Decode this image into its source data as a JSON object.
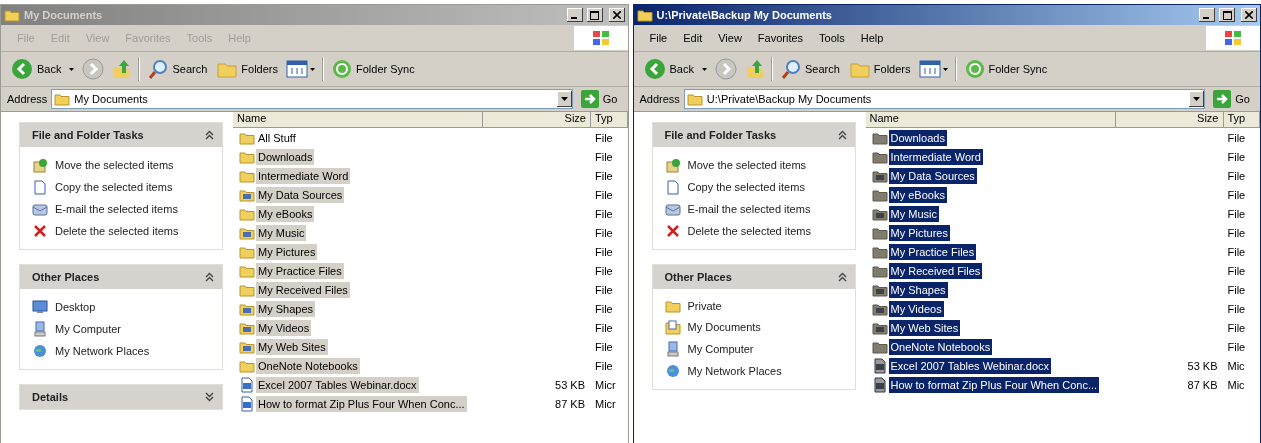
{
  "windows": [
    {
      "title": "My Documents",
      "active": false,
      "menu": [
        "File",
        "Edit",
        "View",
        "Favorites",
        "Tools",
        "Help"
      ],
      "toolbar": {
        "back": "Back",
        "search": "Search",
        "folders": "Folders",
        "sync": "Folder Sync"
      },
      "address": {
        "label": "Address",
        "value": "My Documents",
        "go": "Go"
      },
      "panels": [
        {
          "title": "File and Folder Tasks",
          "expanded": true,
          "items": [
            {
              "label": "Move the selected items",
              "kind": "move"
            },
            {
              "label": "Copy the selected items",
              "kind": "copy"
            },
            {
              "label": "E-mail the selected items",
              "kind": "email"
            },
            {
              "label": "Delete the selected items",
              "kind": "delete"
            }
          ]
        },
        {
          "title": "Other Places",
          "expanded": true,
          "items": [
            {
              "label": "Desktop",
              "kind": "desktop"
            },
            {
              "label": "My Computer",
              "kind": "computer"
            },
            {
              "label": "My Network Places",
              "kind": "network"
            }
          ]
        },
        {
          "title": "Details",
          "expanded": false
        }
      ],
      "columns": [
        "Name",
        "Size",
        "Typ"
      ],
      "files": [
        {
          "name": "All Stuff",
          "type": "File",
          "kind": "folder",
          "selected": false
        },
        {
          "name": "Downloads",
          "type": "File",
          "kind": "folder",
          "selected": true
        },
        {
          "name": "Intermediate Word",
          "type": "File",
          "kind": "folder",
          "selected": true
        },
        {
          "name": "My Data Sources",
          "type": "File",
          "kind": "special",
          "selected": true
        },
        {
          "name": "My eBooks",
          "type": "File",
          "kind": "folder",
          "selected": true
        },
        {
          "name": "My Music",
          "type": "File",
          "kind": "special",
          "selected": true
        },
        {
          "name": "My Pictures",
          "type": "File",
          "kind": "folder",
          "selected": true
        },
        {
          "name": "My Practice Files",
          "type": "File",
          "kind": "folder",
          "selected": true
        },
        {
          "name": "My Received Files",
          "type": "File",
          "kind": "folder",
          "selected": true
        },
        {
          "name": "My Shapes",
          "type": "File",
          "kind": "special",
          "selected": true
        },
        {
          "name": "My Videos",
          "type": "File",
          "kind": "special",
          "selected": true
        },
        {
          "name": "My Web Sites",
          "type": "File",
          "kind": "special",
          "selected": true
        },
        {
          "name": "OneNote Notebooks",
          "type": "File",
          "kind": "folder",
          "selected": true
        },
        {
          "name": "Excel 2007 Tables Webinar.docx",
          "size": "53 KB",
          "type": "Micr",
          "kind": "document",
          "selected": true
        },
        {
          "name": "How to format Zip Plus Four When Conc...",
          "size": "87 KB",
          "type": "Micr",
          "kind": "document",
          "selected": true
        }
      ]
    },
    {
      "title": "U:\\Private\\Backup My Documents",
      "active": true,
      "menu": [
        "File",
        "Edit",
        "View",
        "Favorites",
        "Tools",
        "Help"
      ],
      "toolbar": {
        "back": "Back",
        "search": "Search",
        "folders": "Folders",
        "sync": "Folder Sync"
      },
      "address": {
        "label": "Address",
        "value": "U:\\Private\\Backup My Documents",
        "go": "Go"
      },
      "panels": [
        {
          "title": "File and Folder Tasks",
          "expanded": true,
          "items": [
            {
              "label": "Move the selected items",
              "kind": "move"
            },
            {
              "label": "Copy the selected items",
              "kind": "copy"
            },
            {
              "label": "E-mail the selected items",
              "kind": "email"
            },
            {
              "label": "Delete the selected items",
              "kind": "delete"
            }
          ]
        },
        {
          "title": "Other Places",
          "expanded": true,
          "items": [
            {
              "label": "Private",
              "kind": "folder"
            },
            {
              "label": "My Documents",
              "kind": "documents"
            },
            {
              "label": "My Computer",
              "kind": "computer"
            },
            {
              "label": "My Network Places",
              "kind": "network"
            }
          ]
        }
      ],
      "columns": [
        "Name",
        "Size",
        "Typ"
      ],
      "files": [
        {
          "name": "Downloads",
          "type": "File",
          "kind": "folder",
          "selected": true
        },
        {
          "name": "Intermediate Word",
          "type": "File",
          "kind": "folder",
          "selected": true
        },
        {
          "name": "My Data Sources",
          "type": "File",
          "kind": "special",
          "selected": true
        },
        {
          "name": "My eBooks",
          "type": "File",
          "kind": "folder",
          "selected": true
        },
        {
          "name": "My Music",
          "type": "File",
          "kind": "special",
          "selected": true
        },
        {
          "name": "My Pictures",
          "type": "File",
          "kind": "folder",
          "selected": true
        },
        {
          "name": "My Practice Files",
          "type": "File",
          "kind": "folder",
          "selected": true
        },
        {
          "name": "My Received Files",
          "type": "File",
          "kind": "folder",
          "selected": true
        },
        {
          "name": "My Shapes",
          "type": "File",
          "kind": "special",
          "selected": true
        },
        {
          "name": "My Videos",
          "type": "File",
          "kind": "special",
          "selected": true
        },
        {
          "name": "My Web Sites",
          "type": "File",
          "kind": "special",
          "selected": true
        },
        {
          "name": "OneNote Notebooks",
          "type": "File",
          "kind": "folder",
          "selected": true
        },
        {
          "name": "Excel 2007 Tables Webinar.docx",
          "size": "53 KB",
          "type": "Mic",
          "kind": "document",
          "selected": true
        },
        {
          "name": "How to format Zip Plus Four When Conc...",
          "size": "87 KB",
          "type": "Mic",
          "kind": "document",
          "selected": true
        }
      ]
    }
  ]
}
